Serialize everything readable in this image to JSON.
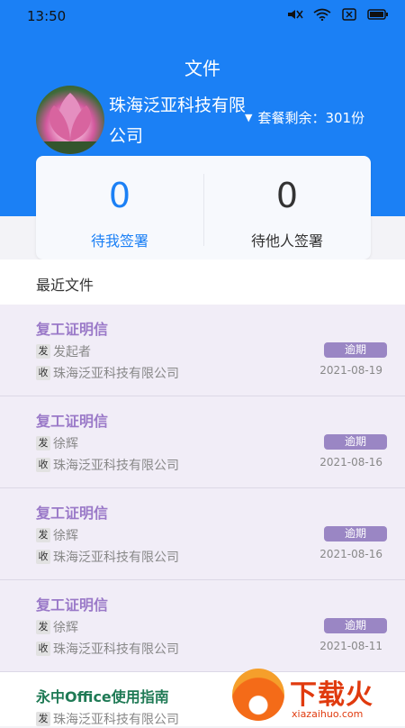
{
  "status": {
    "time": "13:50"
  },
  "header": {
    "title": "文件",
    "company": "珠海泛亚科技有限公司",
    "plan_label": "套餐剩余：301份"
  },
  "counts": {
    "mine": {
      "value": "0",
      "label": "待我签署"
    },
    "others": {
      "value": "0",
      "label": "待他人签署"
    }
  },
  "recent": {
    "title": "最近文件"
  },
  "docs": [
    {
      "title": "复工证明信",
      "send_tag": "发",
      "sender": "发起者",
      "recv_tag": "收",
      "receiver": "珠海泛亚科技有限公司",
      "badge": "逾期",
      "date": "2021-08-19"
    },
    {
      "title": "复工证明信",
      "send_tag": "发",
      "sender": "徐辉",
      "recv_tag": "收",
      "receiver": "珠海泛亚科技有限公司",
      "badge": "逾期",
      "date": "2021-08-16"
    },
    {
      "title": "复工证明信",
      "send_tag": "发",
      "sender": "徐辉",
      "recv_tag": "收",
      "receiver": "珠海泛亚科技有限公司",
      "badge": "逾期",
      "date": "2021-08-16"
    },
    {
      "title": "复工证明信",
      "send_tag": "发",
      "sender": "徐辉",
      "recv_tag": "收",
      "receiver": "珠海泛亚科技有限公司",
      "badge": "逾期",
      "date": "2021-08-11"
    }
  ],
  "last_doc": {
    "title": "永中Office使用指南",
    "send_tag": "发",
    "sender": "珠海泛亚科技有限公司"
  },
  "watermark": {
    "text": "下载火",
    "sub": "xiazaihuo.com"
  }
}
